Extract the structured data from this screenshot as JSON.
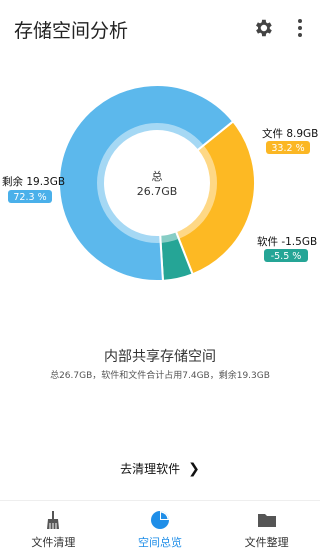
{
  "header": {
    "title": "存储空间分析",
    "settings_icon": "gear-icon",
    "more_icon": "more-vert-icon"
  },
  "chart_data": {
    "type": "pie",
    "donut": true,
    "center_label": "总",
    "center_value": "26.7GB",
    "slices": [
      {
        "label": "剩余 19.3GB",
        "percent_label": "72.3 %",
        "value": 72.3,
        "color": "#5cb8ec",
        "badge_color": "#4ab0ea"
      },
      {
        "label": "文件 8.9GB",
        "percent_label": "33.2 %",
        "value": 33.2,
        "color": "#fdb923",
        "badge_color": "#fbb724"
      },
      {
        "label": "软件 -1.5GB",
        "percent_label": "-5.5 %",
        "value": 5.5,
        "color": "#25a596",
        "badge_color": "#25a596"
      }
    ]
  },
  "summary": {
    "title": "内部共享存储空间",
    "detail": "总26.7GB，软件和文件合计占用7.4GB，剩余19.3GB"
  },
  "cta": {
    "label": "去清理软件",
    "icon": "chevron-right-icon"
  },
  "nav": {
    "items": [
      {
        "label": "文件清理",
        "icon": "broom-icon",
        "active": false
      },
      {
        "label": "空间总览",
        "icon": "pie-chart-icon",
        "active": true
      },
      {
        "label": "文件整理",
        "icon": "folder-icon",
        "active": false
      }
    ],
    "active_color": "#1f8ee8",
    "inactive_color": "#555555"
  }
}
